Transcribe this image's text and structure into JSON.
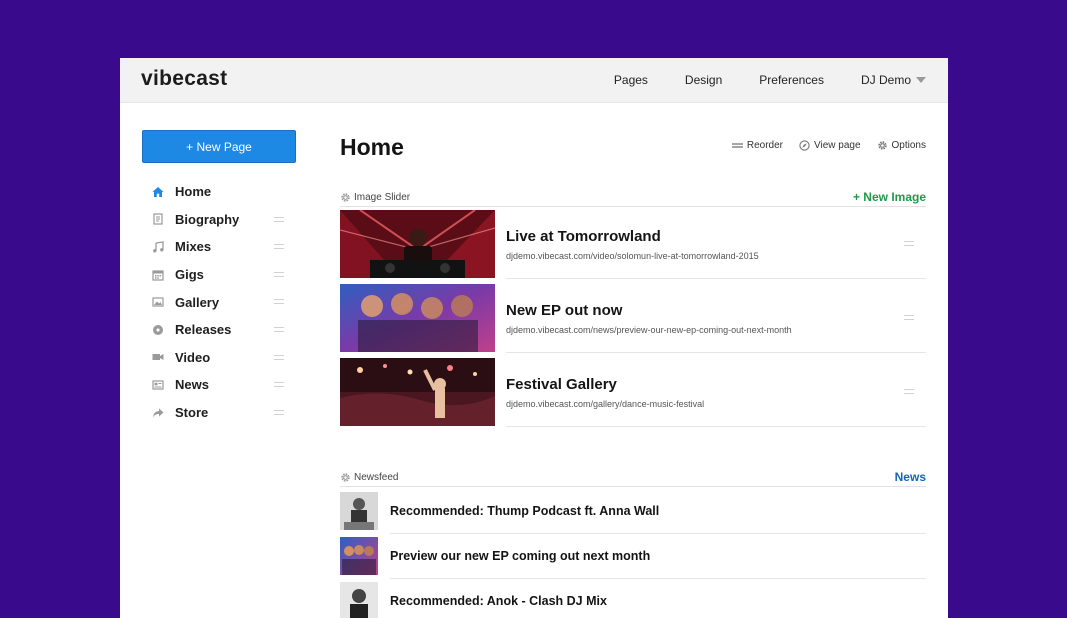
{
  "app": {
    "logo": "vibecast"
  },
  "nav": {
    "items": [
      "Pages",
      "Design",
      "Preferences"
    ],
    "user": "DJ Demo"
  },
  "sidebar": {
    "new_page_label": "+ New Page",
    "items": [
      {
        "label": "Home",
        "icon": "home-icon"
      },
      {
        "label": "Biography",
        "icon": "document-icon"
      },
      {
        "label": "Mixes",
        "icon": "music-note-icon"
      },
      {
        "label": "Gigs",
        "icon": "calendar-icon"
      },
      {
        "label": "Gallery",
        "icon": "image-icon"
      },
      {
        "label": "Releases",
        "icon": "disc-icon"
      },
      {
        "label": "Video",
        "icon": "video-camera-icon"
      },
      {
        "label": "News",
        "icon": "newspaper-icon"
      },
      {
        "label": "Store",
        "icon": "share-arrow-icon"
      }
    ]
  },
  "page": {
    "title": "Home",
    "actions": {
      "reorder": "Reorder",
      "view_page": "View page",
      "options": "Options"
    }
  },
  "image_slider": {
    "label": "Image Slider",
    "add_label": "+ New Image",
    "add_color": "#1e9a4a",
    "items": [
      {
        "title": "Live at Tomorrowland",
        "url": "djdemo.vibecast.com/video/solomun-live-at-tomorrowland-2015"
      },
      {
        "title": "New EP out now",
        "url": "djdemo.vibecast.com/news/preview-our-new-ep-coming-out-next-month"
      },
      {
        "title": "Festival Gallery",
        "url": "djdemo.vibecast.com/gallery/dance-music-festival"
      }
    ]
  },
  "newsfeed": {
    "label": "Newsfeed",
    "link_label": "News",
    "link_color": "#1565c0",
    "items": [
      {
        "title": "Recommended: Thump Podcast ft. Anna Wall"
      },
      {
        "title": "Preview our new EP coming out next month"
      },
      {
        "title": "Recommended: Anok - Clash DJ Mix"
      }
    ]
  },
  "colors": {
    "background": "#3a0a8c",
    "primary_button": "#1e88e5",
    "home_icon": "#1e88e5"
  }
}
